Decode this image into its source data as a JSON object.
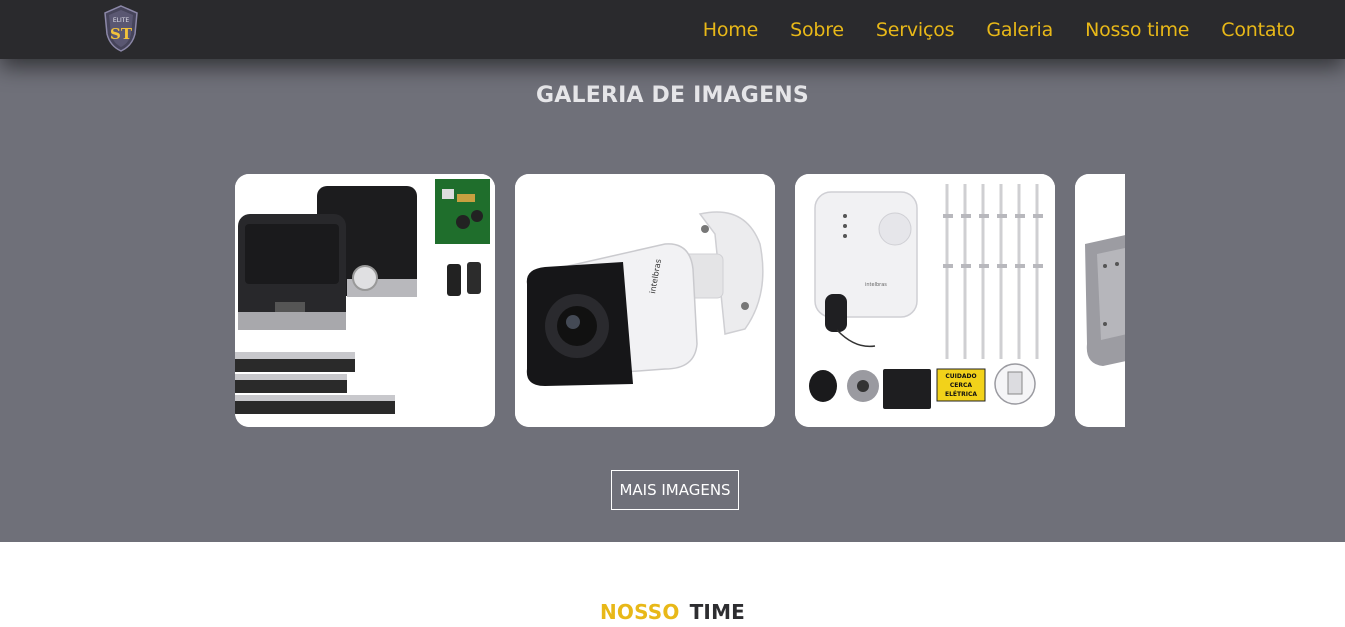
{
  "navbar": {
    "logo_text_top": "ELITE",
    "logo_text_main": "ST",
    "links": [
      "Home",
      "Sobre",
      "Serviços",
      "Galeria",
      "Nosso time",
      "Contato"
    ]
  },
  "gallery": {
    "title": "GALERIA DE IMAGENS",
    "button_label": "MAIS IMAGENS",
    "images": [
      {
        "icon": "gate-motor-kit-image"
      },
      {
        "icon": "security-camera-image",
        "brand": "intelbras"
      },
      {
        "icon": "electric-fence-kit-image",
        "brand": "intelbras",
        "sign_lines": [
          "CUIDADO",
          "CERCA",
          "ELÉTRICA"
        ]
      },
      {
        "icon": "metal-box-image"
      }
    ]
  },
  "team": {
    "title_part1": "NOSSO",
    "title_part2": "TIME"
  },
  "colors": {
    "accent": "#e8b818",
    "navbar_bg": "#2a2a2d",
    "gallery_bg": "#6f7079"
  }
}
